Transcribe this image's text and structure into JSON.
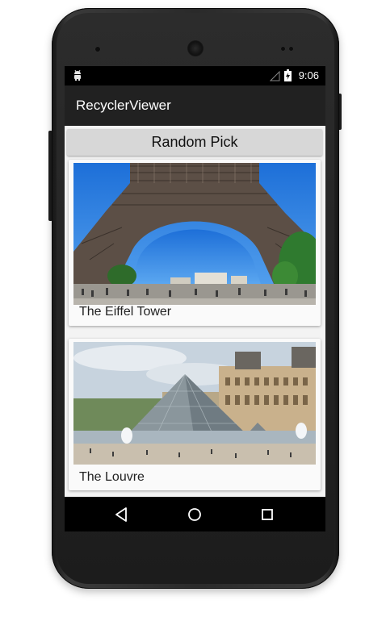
{
  "status_bar": {
    "time": "9:06",
    "notification_icon": "android-icon",
    "signal_icon": "signal-icon",
    "battery_icon": "battery-charging-icon"
  },
  "app_bar": {
    "title": "RecyclerViewer"
  },
  "random_button": {
    "label": "Random Pick"
  },
  "cards": [
    {
      "caption": "The Eiffel Tower",
      "image": "eiffel-tower-photo"
    },
    {
      "caption": "The Louvre",
      "image": "louvre-photo"
    }
  ],
  "nav_bar": {
    "back_icon": "back-icon",
    "home_icon": "home-icon",
    "recents_icon": "recents-icon"
  },
  "colors": {
    "app_bar": "#212121",
    "status_bar": "#000000",
    "button": "#d7d7d7",
    "background": "#f3f3f3"
  }
}
